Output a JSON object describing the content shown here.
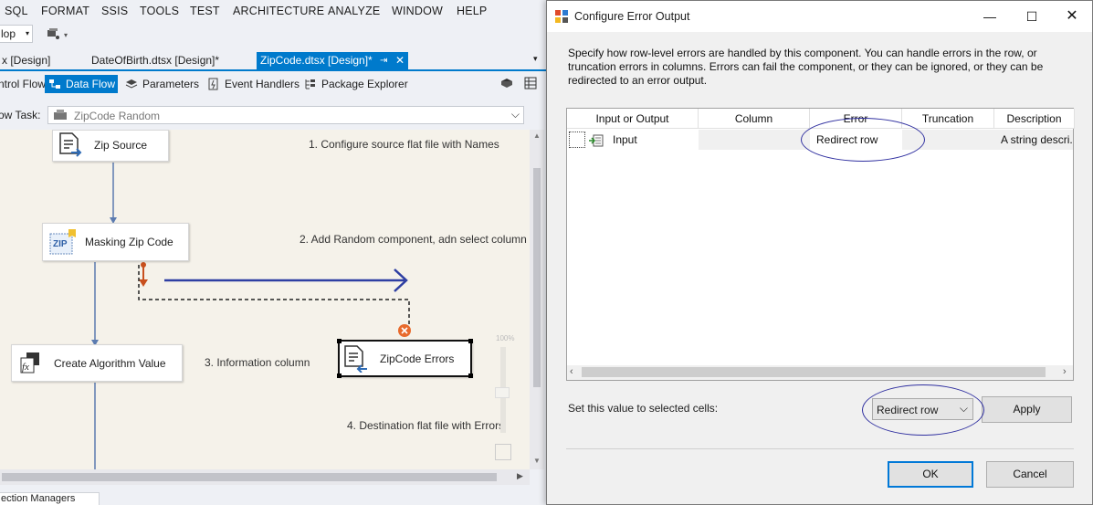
{
  "menu": [
    "SQL",
    "FORMAT",
    "SSIS",
    "TOOLS",
    "TEST",
    "ARCHITECTURE",
    "ANALYZE",
    "WINDOW",
    "HELP"
  ],
  "toolbar": {
    "solution_combo": "lop"
  },
  "doc_tabs": [
    {
      "label": "x [Design]"
    },
    {
      "label": "DateOfBirth.dtsx [Design]*"
    },
    {
      "label": "ZipCode.dtsx [Design]*"
    }
  ],
  "designer_tabs": [
    "ntrol Flow",
    "Data Flow",
    "Parameters",
    "Event Handlers",
    "Package Explorer"
  ],
  "task": {
    "label": "ow Task:",
    "value": "ZipCode Random"
  },
  "nodes": {
    "zip_source": "Zip Source",
    "masking": "Masking Zip Code",
    "algorithm": "Create Algorithm Value",
    "errors": "ZipCode Errors",
    "zip_badge": "ZIP"
  },
  "notes": [
    "1. Configure source flat file with Names",
    "2. Add Random component, adn select column",
    "3. Information column",
    "4. Destination flat file with Errors"
  ],
  "zoom_label": "100%",
  "bottom_tab": "ection Managers",
  "dialog": {
    "title": "Configure Error Output",
    "description": "Specify how row-level errors are handled by this component. You can handle errors in the row, or truncation errors in columns. Errors can fail the component, or they can be ignored, or they can be redirected to an error output.",
    "columns": [
      "Input or Output",
      "Column",
      "Error",
      "Truncation",
      "Description"
    ],
    "row": {
      "io": "Input",
      "column": "",
      "error": "Redirect row",
      "truncation": "",
      "description": "A string descri..."
    },
    "set_label": "Set this value to selected cells:",
    "set_value": "Redirect row",
    "apply": "Apply",
    "ok": "OK",
    "cancel": "Cancel"
  },
  "colors": {
    "accent": "#007acc",
    "arrow": "#2e3fa3",
    "error_path": "#c8501e",
    "annotation": "#3030a0"
  }
}
